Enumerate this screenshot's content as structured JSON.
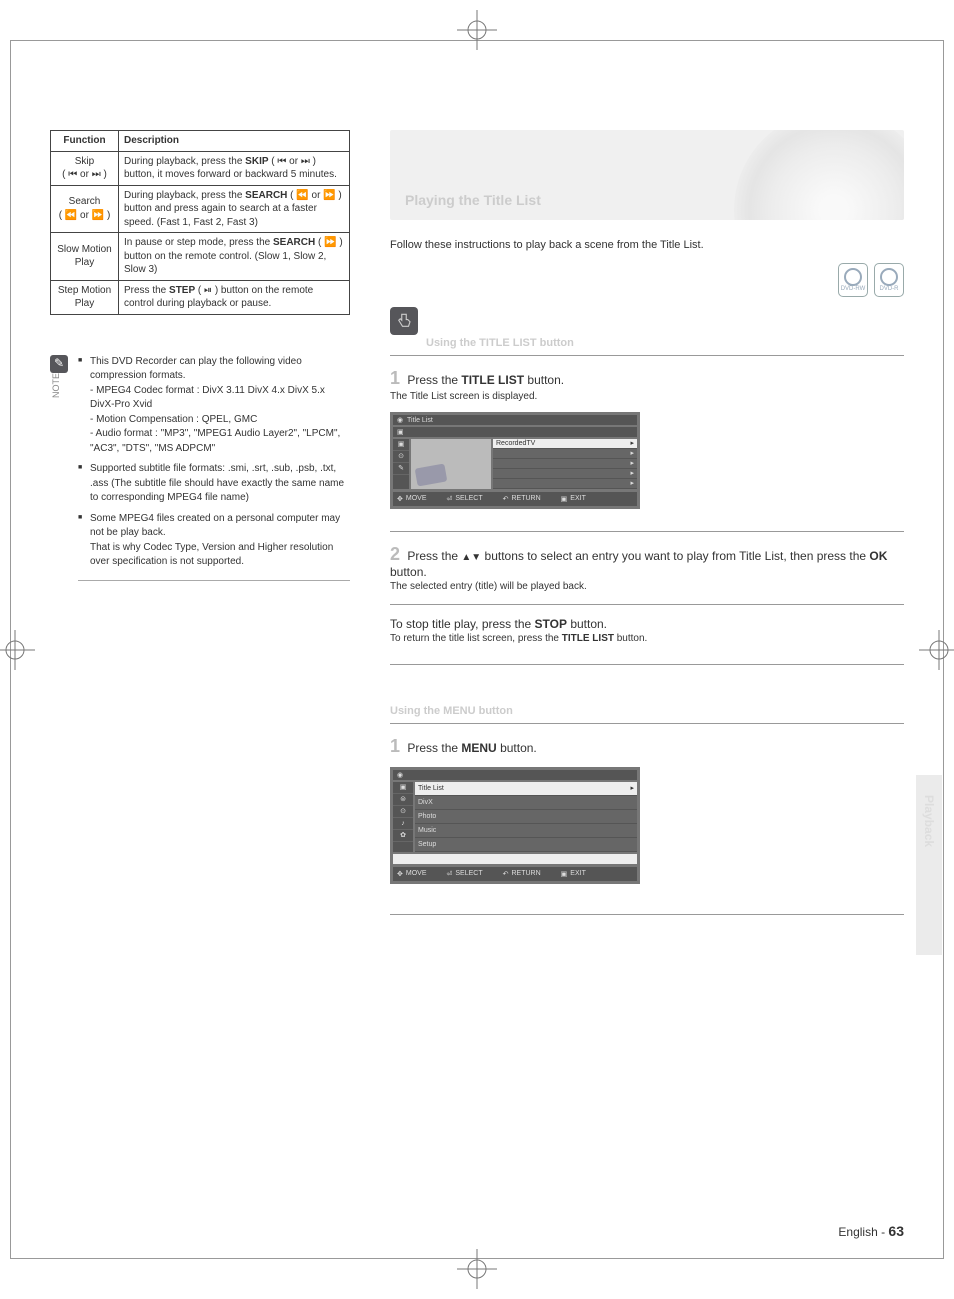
{
  "function_table": {
    "headers": [
      "Function",
      "Description"
    ],
    "rows": [
      {
        "fn": "Skip",
        "icons": "( ⏮ or ⏭ )",
        "desc_a": "During playback, press the ",
        "desc_b": "SKIP",
        "desc_c": " ( ⏮ or ⏭ ) button, it moves forward or backward 5 minutes."
      },
      {
        "fn": "Search",
        "icons": "( ⏪ or ⏩ )",
        "desc_a": "During playback, press the ",
        "desc_b": "SEARCH",
        "desc_c": " ( ⏪ or ⏩ ) button and press again to search at a faster speed. (Fast 1, Fast 2, Fast 3)"
      },
      {
        "fn": "Slow Motion Play",
        "icons": "",
        "desc_a": "In pause or step mode, press the ",
        "desc_b": "SEARCH",
        "desc_c": " ( ⏩ ) button on the remote control. (Slow 1, Slow 2, Slow 3)"
      },
      {
        "fn": "Step Motion Play",
        "icons": "",
        "desc_a": "Press the ",
        "desc_b": "STEP",
        "desc_c": " ( ⏯ ) button on the remote control during playback or pause."
      }
    ]
  },
  "note_label": "NOTE",
  "notes": [
    "This DVD Recorder can play the following video compression formats.\n- MPEG4 Codec format : DivX 3.11 DivX 4.x DivX 5.x DivX-Pro Xvid\n- Motion Compensation : QPEL, GMC\n- Audio format : \"MP3\", \"MPEG1 Audio Layer2\", \"LPCM\", \"AC3\", \"DTS\", \"MS ADPCM\"",
    "Supported subtitle file formats: .smi, .srt, .sub, .psb, .txt, .ass (The subtitle file should have exactly the same name to corresponding MPEG4 file name)",
    "Some MPEG4 files created on a personal computer may not be play back.\nThat is why Codec Type, Version and Higher resolution over specification is not supported."
  ],
  "right": {
    "heading": "Playing the Title List",
    "intro": "Follow these instructions to play back a scene from the Title List.",
    "disc_labels": [
      "DVD-RW",
      "DVD-R"
    ],
    "method1_label": "Using the TITLE LIST button",
    "step1": {
      "num": "1",
      "pre": "Press the ",
      "bold": "TITLE LIST",
      "post": " button.",
      "sub": "The Title List screen is displayed."
    },
    "title_list_ui": {
      "selected": "RecordedTV",
      "items": [
        "RecordedTV",
        "",
        "",
        "",
        ""
      ],
      "nav": [
        "MOVE",
        "SELECT",
        "RETURN",
        "EXIT"
      ]
    },
    "step2": {
      "num": "2",
      "text_a": "Press the ",
      "arrows": "▲▼",
      "text_b": " buttons to select an entry you want to play from Title List, then press the ",
      "bold": "OK",
      "text_c": " button.",
      "sub": "The selected entry (title) will be played back."
    },
    "step3": {
      "pre": "To stop title play, press the ",
      "bold": "STOP",
      "post": " button.",
      "sub_a": "To return the title list screen, press the ",
      "sub_bold": "TITLE LIST",
      "sub_b": " button."
    },
    "method2_label": "Using the MENU button",
    "step_m2": {
      "num": "1",
      "pre": "Press the ",
      "bold": "MENU",
      "post": " button."
    },
    "menu_ui": {
      "items": [
        "Title List",
        "DivX",
        "Photo",
        "Music",
        "Setup"
      ],
      "nav": [
        "MOVE",
        "SELECT",
        "RETURN",
        "EXIT"
      ]
    }
  },
  "sidetab_label": "Playback",
  "footer": {
    "lang": "English - ",
    "page": "63"
  }
}
